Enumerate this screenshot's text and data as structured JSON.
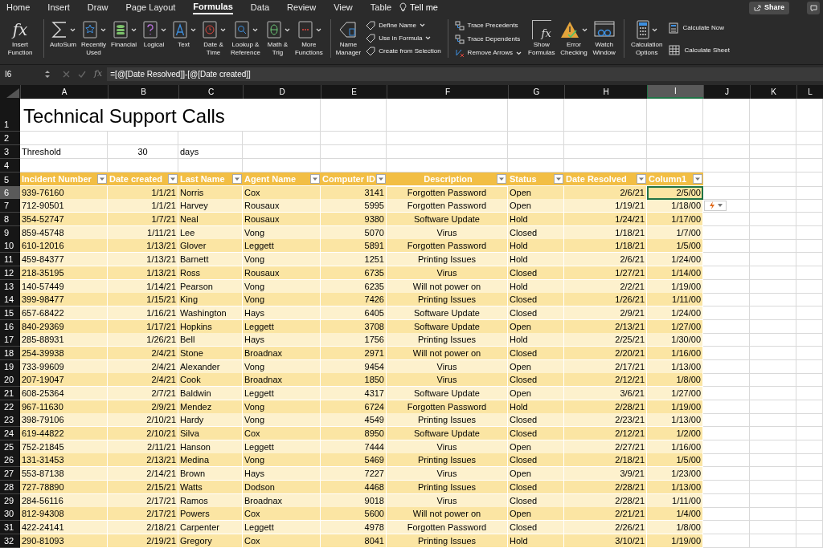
{
  "ribbon": {
    "tabs": [
      {
        "label": "Home",
        "selected": false
      },
      {
        "label": "Insert",
        "selected": false
      },
      {
        "label": "Draw",
        "selected": false
      },
      {
        "label": "Page Layout",
        "selected": false
      },
      {
        "label": "Formulas",
        "selected": true
      },
      {
        "label": "Data",
        "selected": false
      },
      {
        "label": "Review",
        "selected": false
      },
      {
        "label": "View",
        "selected": false
      },
      {
        "label": "Table",
        "selected": false
      }
    ],
    "tell_me": "Tell me",
    "share": "Share",
    "insert_function": {
      "symbol": "fx",
      "lines": [
        "Insert",
        "Function"
      ]
    },
    "function_library": [
      {
        "lines": [
          "AutoSum"
        ],
        "dropdown": true
      },
      {
        "lines": [
          "Recently",
          "Used"
        ],
        "dropdown": true
      },
      {
        "lines": [
          "Financial"
        ],
        "dropdown": true
      },
      {
        "lines": [
          "Logical"
        ],
        "dropdown": true
      },
      {
        "lines": [
          "Text"
        ],
        "dropdown": true
      },
      {
        "lines": [
          "Date &",
          "Time"
        ],
        "dropdown": true
      },
      {
        "lines": [
          "Lookup &",
          "Reference"
        ],
        "dropdown": true
      },
      {
        "lines": [
          "Math &",
          "Trig"
        ],
        "dropdown": true
      },
      {
        "lines": [
          "More",
          "Functions"
        ],
        "dropdown": true
      }
    ],
    "name_manager": {
      "lines": [
        "Name",
        "Manager"
      ]
    },
    "defined_names": [
      {
        "label": "Define Name",
        "dropdown": true
      },
      {
        "label": "Use in Formula",
        "dropdown": true
      },
      {
        "label": "Create from Selection",
        "dropdown": false
      }
    ],
    "auditing": [
      {
        "label": "Trace Precedents",
        "dropdown": false
      },
      {
        "label": "Trace Dependents",
        "dropdown": false
      },
      {
        "label": "Remove Arrows",
        "dropdown": true
      }
    ],
    "auditing_buttons": [
      {
        "lines": [
          "Show",
          "Formulas"
        ],
        "symbol": "fx",
        "dropdown": false
      },
      {
        "lines": [
          "Error",
          "Checking"
        ],
        "dropdown": true
      },
      {
        "lines": [
          "Watch",
          "Window"
        ],
        "dropdown": false
      }
    ],
    "calculation_options": {
      "lines": [
        "Calculation",
        "Options"
      ],
      "dropdown": true
    },
    "calculate": [
      {
        "label": "Calculate Now"
      },
      {
        "label": "Calculate Sheet"
      }
    ]
  },
  "formula_bar": {
    "name_box": "I6",
    "symbol": "fx",
    "formula": "=[@[Date Resolved]]-[@[Date created]]"
  },
  "sheet": {
    "columns": [
      {
        "letter": "A",
        "selected": false
      },
      {
        "letter": "B",
        "selected": false
      },
      {
        "letter": "C",
        "selected": false
      },
      {
        "letter": "D",
        "selected": false
      },
      {
        "letter": "E",
        "selected": false
      },
      {
        "letter": "F",
        "selected": false
      },
      {
        "letter": "G",
        "selected": false
      },
      {
        "letter": "H",
        "selected": false
      },
      {
        "letter": "I",
        "selected": true
      },
      {
        "letter": "J",
        "selected": false
      },
      {
        "letter": "K",
        "selected": false
      },
      {
        "letter": "L",
        "selected": false
      }
    ],
    "rows": [
      {
        "number": "1",
        "selected": false,
        "kind": "title",
        "cells": [
          "Technical Support Calls"
        ]
      },
      {
        "number": "2",
        "selected": false,
        "kind": "blank"
      },
      {
        "number": "3",
        "selected": false,
        "kind": "values",
        "cells": [
          "Threshold",
          "30",
          "days"
        ]
      },
      {
        "number": "4",
        "selected": false,
        "kind": "blank"
      },
      {
        "number": "5",
        "selected": false,
        "kind": "header",
        "cells": [
          "Incident Number",
          "Date created",
          "Last Name",
          "Agent Name",
          "Computer ID",
          "Description",
          "Status",
          "Date Resolved",
          "Column1"
        ]
      },
      {
        "number": "6",
        "selected": true,
        "kind": "data",
        "cells": [
          "939-76160",
          "1/1/21",
          "Norris",
          "Cox",
          "3141",
          "Forgotten Password",
          "Open",
          "2/6/21",
          "2/5/00"
        ]
      },
      {
        "number": "7",
        "selected": false,
        "kind": "data",
        "cells": [
          "712-90501",
          "1/1/21",
          "Harvey",
          "Rousaux",
          "5995",
          "Forgotten Password",
          "Open",
          "1/19/21",
          "1/18/00"
        ]
      },
      {
        "number": "8",
        "selected": false,
        "kind": "data",
        "cells": [
          "354-52747",
          "1/7/21",
          "Neal",
          "Rousaux",
          "9380",
          "Software Update",
          "Hold",
          "1/24/21",
          "1/17/00"
        ]
      },
      {
        "number": "9",
        "selected": false,
        "kind": "data",
        "cells": [
          "859-45748",
          "1/11/21",
          "Lee",
          "Vong",
          "5070",
          "Virus",
          "Closed",
          "1/18/21",
          "1/7/00"
        ]
      },
      {
        "number": "10",
        "selected": false,
        "kind": "data",
        "cells": [
          "610-12016",
          "1/13/21",
          "Glover",
          "Leggett",
          "5891",
          "Forgotten Password",
          "Hold",
          "1/18/21",
          "1/5/00"
        ]
      },
      {
        "number": "11",
        "selected": false,
        "kind": "data",
        "cells": [
          "459-84377",
          "1/13/21",
          "Barnett",
          "Vong",
          "1251",
          "Printing Issues",
          "Hold",
          "2/6/21",
          "1/24/00"
        ]
      },
      {
        "number": "12",
        "selected": false,
        "kind": "data",
        "cells": [
          "218-35195",
          "1/13/21",
          "Ross",
          "Rousaux",
          "6735",
          "Virus",
          "Closed",
          "1/27/21",
          "1/14/00"
        ]
      },
      {
        "number": "13",
        "selected": false,
        "kind": "data",
        "cells": [
          "140-57449",
          "1/14/21",
          "Pearson",
          "Vong",
          "6235",
          "Will not power on",
          "Hold",
          "2/2/21",
          "1/19/00"
        ]
      },
      {
        "number": "14",
        "selected": false,
        "kind": "data",
        "cells": [
          "399-98477",
          "1/15/21",
          "King",
          "Vong",
          "7426",
          "Printing Issues",
          "Closed",
          "1/26/21",
          "1/11/00"
        ]
      },
      {
        "number": "15",
        "selected": false,
        "kind": "data",
        "cells": [
          "657-68422",
          "1/16/21",
          "Washington",
          "Hays",
          "6405",
          "Software Update",
          "Closed",
          "2/9/21",
          "1/24/00"
        ]
      },
      {
        "number": "16",
        "selected": false,
        "kind": "data",
        "cells": [
          "840-29369",
          "1/17/21",
          "Hopkins",
          "Leggett",
          "3708",
          "Software Update",
          "Open",
          "2/13/21",
          "1/27/00"
        ]
      },
      {
        "number": "17",
        "selected": false,
        "kind": "data",
        "cells": [
          "285-88931",
          "1/26/21",
          "Bell",
          "Hays",
          "1756",
          "Printing Issues",
          "Hold",
          "2/25/21",
          "1/30/00"
        ]
      },
      {
        "number": "18",
        "selected": false,
        "kind": "data",
        "cells": [
          "254-39938",
          "2/4/21",
          "Stone",
          "Broadnax",
          "2971",
          "Will not power on",
          "Closed",
          "2/20/21",
          "1/16/00"
        ]
      },
      {
        "number": "19",
        "selected": false,
        "kind": "data",
        "cells": [
          "733-99609",
          "2/4/21",
          "Alexander",
          "Vong",
          "9454",
          "Virus",
          "Open",
          "2/17/21",
          "1/13/00"
        ]
      },
      {
        "number": "20",
        "selected": false,
        "kind": "data",
        "cells": [
          "207-19047",
          "2/4/21",
          "Cook",
          "Broadnax",
          "1850",
          "Virus",
          "Closed",
          "2/12/21",
          "1/8/00"
        ]
      },
      {
        "number": "21",
        "selected": false,
        "kind": "data",
        "cells": [
          "608-25364",
          "2/7/21",
          "Baldwin",
          "Leggett",
          "4317",
          "Software Update",
          "Open",
          "3/6/21",
          "1/27/00"
        ]
      },
      {
        "number": "22",
        "selected": false,
        "kind": "data",
        "cells": [
          "967-11630",
          "2/9/21",
          "Mendez",
          "Vong",
          "6724",
          "Forgotten Password",
          "Hold",
          "2/28/21",
          "1/19/00"
        ]
      },
      {
        "number": "23",
        "selected": false,
        "kind": "data",
        "cells": [
          "398-79106",
          "2/10/21",
          "Hardy",
          "Vong",
          "4549",
          "Printing Issues",
          "Closed",
          "2/23/21",
          "1/13/00"
        ]
      },
      {
        "number": "24",
        "selected": false,
        "kind": "data",
        "cells": [
          "619-44822",
          "2/10/21",
          "Silva",
          "Cox",
          "8950",
          "Software Update",
          "Closed",
          "2/12/21",
          "1/2/00"
        ]
      },
      {
        "number": "25",
        "selected": false,
        "kind": "data",
        "cells": [
          "752-21845",
          "2/11/21",
          "Hanson",
          "Leggett",
          "7444",
          "Virus",
          "Open",
          "2/27/21",
          "1/16/00"
        ]
      },
      {
        "number": "26",
        "selected": false,
        "kind": "data",
        "cells": [
          "131-31453",
          "2/13/21",
          "Medina",
          "Vong",
          "5469",
          "Printing Issues",
          "Closed",
          "2/18/21",
          "1/5/00"
        ]
      },
      {
        "number": "27",
        "selected": false,
        "kind": "data",
        "cells": [
          "553-87138",
          "2/14/21",
          "Brown",
          "Hays",
          "7227",
          "Virus",
          "Open",
          "3/9/21",
          "1/23/00"
        ]
      },
      {
        "number": "28",
        "selected": false,
        "kind": "data",
        "cells": [
          "727-78890",
          "2/15/21",
          "Watts",
          "Dodson",
          "4468",
          "Printing Issues",
          "Closed",
          "2/28/21",
          "1/13/00"
        ]
      },
      {
        "number": "29",
        "selected": false,
        "kind": "data",
        "cells": [
          "284-56116",
          "2/17/21",
          "Ramos",
          "Broadnax",
          "9018",
          "Virus",
          "Closed",
          "2/28/21",
          "1/11/00"
        ]
      },
      {
        "number": "30",
        "selected": false,
        "kind": "data",
        "cells": [
          "812-94308",
          "2/17/21",
          "Powers",
          "Cox",
          "5600",
          "Will not power on",
          "Open",
          "2/21/21",
          "1/4/00"
        ]
      },
      {
        "number": "31",
        "selected": false,
        "kind": "data",
        "cells": [
          "422-24141",
          "2/18/21",
          "Carpenter",
          "Leggett",
          "4978",
          "Forgotten Password",
          "Closed",
          "2/26/21",
          "1/8/00"
        ]
      },
      {
        "number": "32",
        "selected": false,
        "kind": "data",
        "cells": [
          "290-81093",
          "2/19/21",
          "Gregory",
          "Cox",
          "8041",
          "Printing Issues",
          "Hold",
          "3/10/21",
          "1/19/00"
        ]
      }
    ]
  }
}
